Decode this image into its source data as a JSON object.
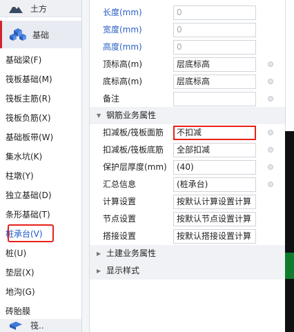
{
  "sidebar": {
    "category_top": {
      "label": "土方",
      "icon": "earthwork-icon"
    },
    "category_active": {
      "label": "基础",
      "icon": "foundation-icon"
    },
    "category_bottom": {
      "label": "筏..",
      "icon": "next-category-icon"
    },
    "items": [
      {
        "label": "基础梁(F)"
      },
      {
        "label": "筏板基础(M)"
      },
      {
        "label": "筏板主筋(R)"
      },
      {
        "label": "筏板负筋(X)"
      },
      {
        "label": "基础板带(W)"
      },
      {
        "label": "集水坑(K)"
      },
      {
        "label": "柱墩(Y)"
      },
      {
        "label": "独立基础(D)"
      },
      {
        "label": "条形基础(T)"
      },
      {
        "label": "桩承台(V)",
        "selected": true
      },
      {
        "label": "桩(U)"
      },
      {
        "label": "垫层(X)"
      },
      {
        "label": "地沟(G)"
      },
      {
        "label": "砖胎膜"
      }
    ],
    "accent_color": "#d0262d",
    "selected_color": "#1a56c9"
  },
  "panel": {
    "rows1": [
      {
        "label": "长度(mm)",
        "value": "0",
        "label_style": "blue",
        "value_style": "gray"
      },
      {
        "label": "宽度(mm)",
        "value": "0",
        "label_style": "blue",
        "value_style": "gray"
      },
      {
        "label": "高度(mm)",
        "value": "0",
        "label_style": "blue",
        "value_style": "gray"
      },
      {
        "label": "顶标高(m)",
        "value": "层底标高",
        "dot": true
      },
      {
        "label": "底标高(m)",
        "value": "层底标高",
        "dot": true
      },
      {
        "label": "备注",
        "value": "",
        "dot": true
      }
    ],
    "group_rebar": {
      "label": "钢筋业务属性",
      "expanded": true
    },
    "rows2": [
      {
        "label": "扣减板/筏板面筋",
        "value": "不扣减",
        "dot": true,
        "highlight": true
      },
      {
        "label": "扣减板/筏板底筋",
        "value": "全部扣减",
        "dot": true
      },
      {
        "label": "保护层厚度(mm)",
        "value": "(40)",
        "dot": true
      },
      {
        "label": "汇总信息",
        "value": "(桩承台)",
        "dot": true
      },
      {
        "label": "计算设置",
        "value": "按默认计算设置计算"
      },
      {
        "label": "节点设置",
        "value": "按默认节点设置计算"
      },
      {
        "label": "搭接设置",
        "value": "按默认搭接设置计算"
      }
    ],
    "group_civil": {
      "label": "土建业务属性",
      "expanded": false
    },
    "group_display": {
      "label": "显示样式",
      "expanded": false
    },
    "highlight_color": "#e8201a"
  }
}
